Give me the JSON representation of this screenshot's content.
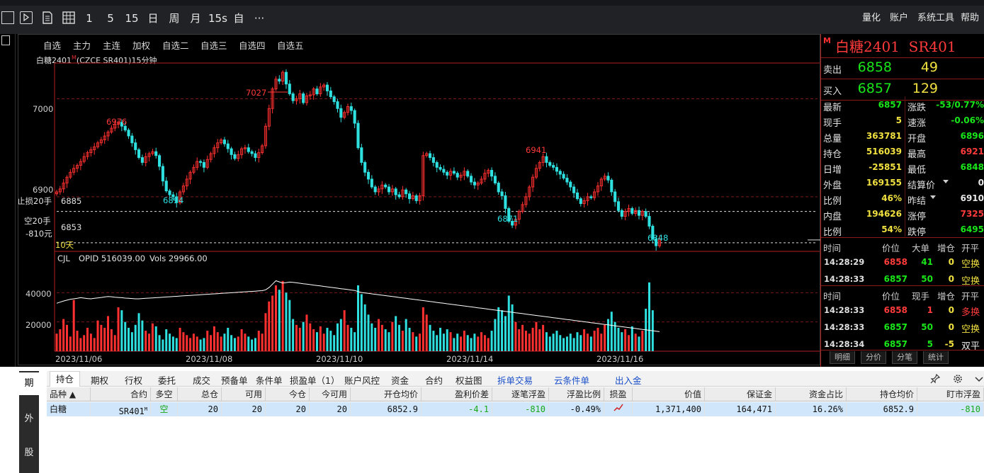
{
  "toolbar": {
    "periods": [
      "1",
      "5",
      "15",
      "日",
      "周",
      "月",
      "15s",
      "自"
    ],
    "more": "···",
    "menus": [
      "量化",
      "账户",
      "系统工具",
      "帮助"
    ]
  },
  "chart": {
    "tabs": [
      "自选",
      "主力",
      "主连",
      "加权",
      "自选二",
      "自选三",
      "自选四",
      "自选五"
    ],
    "title": "白糖2401",
    "title_sup": "M",
    "title_rest": "(CZCE SR401)15分钟",
    "price_axis": [
      "7000",
      "6900"
    ],
    "left_labels": {
      "stop_loss": "止损20手",
      "stop_loss_price": "6885",
      "short": "空20手",
      "short_pnl": "-810元",
      "short_price": "6853"
    },
    "period_label": "10天",
    "annotations": {
      "high_7027": "7027",
      "high_6976": "6976",
      "high_6941": "6941",
      "low_6894": "6894",
      "low_6871": "6871",
      "low_6848": "6848"
    },
    "vol_legend": {
      "name": "CJL",
      "opid": "OPID 516039.00",
      "vols": "Vols 29966.00"
    },
    "vol_axis": [
      "40000",
      "20000"
    ],
    "dates": [
      "2023/11/06",
      "2023/11/08",
      "2023/11/10",
      "2023/11/14",
      "2023/11/16"
    ]
  },
  "chart_data": {
    "type": "candlestick",
    "title": "白糖2401(CZCE SR401)15分钟",
    "ylim": [
      6845,
      7035
    ],
    "close_series": [
      6905,
      6908,
      6914,
      6920,
      6925,
      6929,
      6932,
      6936,
      6941,
      6945,
      6948,
      6951,
      6955,
      6958,
      6962,
      6966,
      6970,
      6974,
      6976,
      6972,
      6968,
      6962,
      6955,
      6948,
      6940,
      6935,
      6941,
      6944,
      6946,
      6942,
      6931,
      6916,
      6906,
      6902,
      6900,
      6894,
      6905,
      6911,
      6918,
      6925,
      6930,
      6936,
      6935,
      6930,
      6938,
      6944,
      6950,
      6955,
      6958,
      6954,
      6949,
      6943,
      6939,
      6943,
      6949,
      6950,
      6946,
      6944,
      6940,
      6945,
      6952,
      6972,
      6990,
      7010,
      7020,
      7018,
      7027,
      7015,
      7005,
      6998,
      7000,
      7005,
      6996,
      7003,
      7004,
      7010,
      7005,
      7012,
      7014,
      7008,
      7002,
      6997,
      6990,
      6981,
      6986,
      6992,
      6988,
      6975,
      6950,
      6935,
      6925,
      6918,
      6910,
      6905,
      6908,
      6912,
      6910,
      6905,
      6908,
      6902,
      6900,
      6907,
      6903,
      6898,
      6901,
      6896,
      6901,
      6942,
      6944,
      6940,
      6935,
      6930,
      6928,
      6925,
      6922,
      6926,
      6924,
      6920,
      6922,
      6926,
      6921,
      6915,
      6912,
      6914,
      6918,
      6924,
      6927,
      6921,
      6914,
      6905,
      6901,
      6888,
      6875,
      6871,
      6877,
      6885,
      6892,
      6900,
      6910,
      6920,
      6929,
      6935,
      6941,
      6935,
      6932,
      6930,
      6926,
      6923,
      6919,
      6915,
      6910,
      6904,
      6898,
      6893,
      6896,
      6900,
      6899,
      6905,
      6911,
      6918,
      6921,
      6917,
      6905,
      6895,
      6886,
      6880,
      6885,
      6888,
      6883,
      6886,
      6881,
      6885,
      6880,
      6870,
      6857,
      6850,
      6857
    ],
    "volume_series": [
      12000,
      15000,
      22000,
      18000,
      10000,
      35000,
      14000,
      9000,
      11000,
      16000,
      12000,
      9000,
      21000,
      18000,
      16000,
      24000,
      15000,
      11000,
      30000,
      28000,
      20000,
      16000,
      13000,
      18000,
      26000,
      21000,
      14000,
      12000,
      19000,
      17000,
      11000,
      8000,
      15000,
      12000,
      10000,
      9000,
      16000,
      13000,
      11000,
      9000,
      12000,
      10000,
      8000,
      9000,
      14000,
      11000,
      17000,
      13000,
      10000,
      12000,
      16000,
      11000,
      9000,
      10000,
      15000,
      12000,
      10000,
      8000,
      9000,
      14000,
      12000,
      26000,
      34000,
      38000,
      45000,
      42000,
      48000,
      40000,
      35000,
      22000,
      18000,
      16000,
      20000,
      25000,
      19000,
      15000,
      13000,
      17000,
      12000,
      16000,
      14000,
      11000,
      19000,
      22000,
      28000,
      18000,
      16000,
      13000,
      45000,
      39000,
      32000,
      25000,
      19000,
      16000,
      22000,
      18000,
      15000,
      13000,
      20000,
      24000,
      18000,
      14000,
      22000,
      16000,
      13000,
      10000,
      12000,
      30000,
      25000,
      18000,
      14000,
      11000,
      16000,
      12000,
      15000,
      13000,
      9000,
      12000,
      10000,
      14000,
      11000,
      9000,
      12000,
      10000,
      13000,
      11000,
      9000,
      14000,
      22000,
      30000,
      28000,
      24000,
      38000,
      32000,
      20000,
      15000,
      18000,
      14000,
      12000,
      16000,
      20000,
      15000,
      18000,
      13000,
      10000,
      12000,
      14000,
      11000,
      9000,
      10000,
      12000,
      9000,
      13000,
      11000,
      15000,
      12000,
      10000,
      14000,
      16000,
      12000,
      18000,
      22000,
      27000,
      20000,
      16000,
      13000,
      15000,
      11000,
      17000,
      12000,
      10000,
      14000,
      29000,
      47000,
      28000
    ],
    "opi_series": [
      515000,
      515500,
      516000,
      516400,
      516800,
      517000,
      517200,
      517500,
      517300,
      517100,
      517000,
      517200,
      517400,
      517600,
      517800,
      518000,
      517900,
      517700,
      517600,
      517500,
      517300,
      517200,
      517100,
      517000,
      517000,
      517100,
      517200,
      517300,
      517400,
      517500,
      517600,
      517700,
      517800,
      517900,
      518000,
      518100,
      518200,
      518300,
      518400,
      518500,
      518600,
      518700,
      518800,
      518900,
      519000,
      519100,
      519200,
      519300,
      519400,
      519500,
      519600,
      519700,
      519800,
      519900,
      520000,
      520100,
      520200,
      520300,
      520400,
      520500,
      520600,
      521000,
      522000,
      523500,
      525000,
      524500,
      524000,
      524200,
      524400,
      524300,
      524100,
      523900,
      523700,
      523500,
      523300,
      523100,
      522900,
      522700,
      522500,
      522300,
      522100,
      521900,
      521700,
      521500,
      521300,
      521100,
      520900,
      520700,
      520200,
      519800,
      519600,
      519400,
      519200,
      519000,
      518800,
      518600,
      518400,
      518200,
      518000,
      517800,
      517600,
      517400,
      517200,
      517000,
      516800,
      516600,
      516400,
      516200,
      516000,
      515800,
      515600,
      515400,
      515200,
      515000,
      514800,
      514600,
      514400,
      514200,
      514000,
      513800,
      513600,
      513400,
      513200,
      513000,
      512800,
      512600,
      512400,
      512200,
      512000,
      511800,
      511600,
      511400,
      511200,
      511000,
      510800,
      510600,
      510400,
      510200,
      510000,
      509800,
      509600,
      509400,
      509200,
      509000,
      508800,
      508600,
      508400,
      508200,
      508000,
      507800,
      507600,
      507400,
      507200,
      507000,
      506800,
      506600,
      506400,
      506200,
      506000,
      505800,
      505600,
      505400,
      505200,
      505000,
      504800,
      504600,
      504400,
      504200,
      504000,
      503800,
      503600,
      503400,
      503200,
      503000,
      502800,
      502600,
      502400
    ]
  },
  "quote": {
    "m": "M",
    "name": "白糖2401",
    "code": "SR401",
    "ask": {
      "label": "卖出",
      "price": "6858",
      "qty": "49"
    },
    "bid": {
      "label": "买入",
      "price": "6857",
      "qty": "129"
    },
    "stats_left": [
      {
        "label": "最新",
        "value": "6857",
        "color": "green"
      },
      {
        "label": "现手",
        "value": "5",
        "color": "yellow"
      },
      {
        "label": "总量",
        "value": "363781",
        "color": "yellow"
      },
      {
        "label": "持仓",
        "value": "516039",
        "color": "yellow"
      },
      {
        "label": "日增",
        "value": "-25851",
        "color": "yellow"
      },
      {
        "label": "外盘",
        "value": "169155",
        "color": "yellow"
      },
      {
        "label": "比例",
        "value": "46%",
        "color": "yellow"
      },
      {
        "label": "内盘",
        "value": "194626",
        "color": "yellow"
      },
      {
        "label": "比例",
        "value": "54%",
        "color": "yellow"
      }
    ],
    "stats_right": [
      {
        "label": "涨跌",
        "value": "-53/0.77%",
        "color": "green"
      },
      {
        "label": "速涨",
        "value": "-0.06%",
        "color": "green"
      },
      {
        "label": "开盘",
        "value": "6896",
        "color": "green"
      },
      {
        "label": "最高",
        "value": "6921",
        "color": "red"
      },
      {
        "label": "最低",
        "value": "6848",
        "color": "green"
      },
      {
        "label": "结算价",
        "value": "0",
        "color": "white"
      },
      {
        "label": "昨结",
        "value": "6910",
        "color": "white"
      },
      {
        "label": "涨停",
        "value": "7325",
        "color": "red"
      },
      {
        "label": "跌停",
        "value": "6495",
        "color": "green"
      }
    ],
    "ticks1_header": [
      "时间",
      "价位",
      "大单",
      "增仓",
      "开平"
    ],
    "ticks1": [
      {
        "time": "14:28:29",
        "price": "6858",
        "qty": "41",
        "oi": "0",
        "type": "空换"
      },
      {
        "time": "14:28:33",
        "price": "6857",
        "qty": "50",
        "oi": "0",
        "type": "空换"
      }
    ],
    "ticks2_header": [
      "时间",
      "价位",
      "现手",
      "增仓",
      "开平"
    ],
    "ticks2": [
      {
        "time": "14:28:33",
        "price": "6858",
        "qty": "1",
        "qcolor": "red",
        "oi": "0",
        "type": "多换"
      },
      {
        "time": "14:28:33",
        "price": "6857",
        "qty": "50",
        "qcolor": "green",
        "oi": "0",
        "type": "空换"
      },
      {
        "time": "14:28:34",
        "price": "6857",
        "qty": "5",
        "qcolor": "green",
        "oi": "-5",
        "type": "双平"
      }
    ],
    "tabs": [
      "明细",
      "分价",
      "分笔",
      "统计"
    ]
  },
  "bottom": {
    "side_tabs": [
      "期",
      "外",
      "股"
    ],
    "tabs": [
      "持仓",
      "期权",
      "行权",
      "委托",
      "成交",
      "预备单",
      "条件单",
      "损盈单（1）",
      "账户风控",
      "资金",
      "合约",
      "权益图",
      "拆单交易",
      "云条件单",
      "出入金"
    ],
    "headers": [
      "品种 ▲",
      "合约",
      "多空",
      "总仓",
      "可用",
      "今仓",
      "今可用",
      "开仓均价",
      "盈利价差",
      "逐笔浮盈",
      "浮盈比例",
      "损盈",
      "价值",
      "保证金",
      "资金占比",
      "持仓均价",
      "盯市浮盈"
    ],
    "row": {
      "variety": "白糖",
      "contract": "SR401",
      "contract_sup": "M",
      "direction": "空",
      "total": "20",
      "available": "20",
      "today": "20",
      "today_avail": "20",
      "open_avg": "6852.9",
      "spread": "-4.1",
      "float_pnl": "-810",
      "float_ratio": "-0.49%",
      "value": "1,371,400",
      "margin": "164,471",
      "fund_ratio": "16.26%",
      "hold_avg": "6852.9",
      "mtm_pnl": "-810"
    }
  }
}
